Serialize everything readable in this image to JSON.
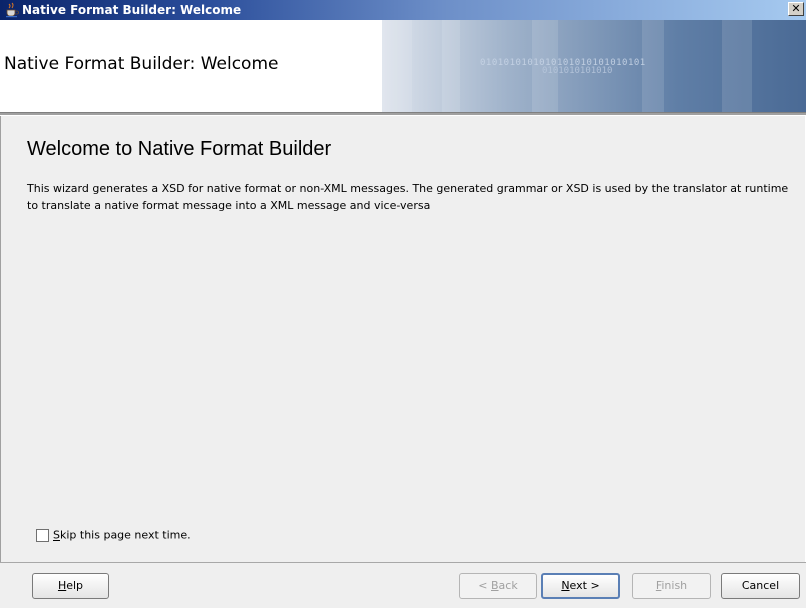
{
  "window": {
    "title": "Native Format Builder: Welcome",
    "close_glyph": "✕"
  },
  "header": {
    "title": "Native Format Builder: Welcome",
    "banner_binary_1": "0101010101010101010101010101",
    "banner_binary_2": "0101010101010"
  },
  "content": {
    "heading": "Welcome to Native Format Builder",
    "description": "This wizard generates a XSD for native format or non-XML messages. The generated grammar or XSD is used by the translator at runtime to translate a native format message into a XML message and vice-versa",
    "skip_checkbox": {
      "checked": false,
      "label_mnemonic": "S",
      "label_rest": "kip this page next time."
    }
  },
  "buttons": {
    "help": {
      "mnemonic": "H",
      "rest": "elp"
    },
    "back": {
      "prefix": "< ",
      "mnemonic": "B",
      "rest": "ack",
      "enabled": false
    },
    "next": {
      "mnemonic": "N",
      "rest": "ext >",
      "enabled": true,
      "default": true
    },
    "finish": {
      "mnemonic": "F",
      "rest": "inish",
      "enabled": false
    },
    "cancel": {
      "label": "Cancel"
    }
  },
  "icons": {
    "app": "coffee-cup-icon",
    "banner": "gear-document-icon",
    "close": "close-icon"
  },
  "colors": {
    "title_bar_start": "#0a246a",
    "title_bar_end": "#a6caf0",
    "content_bg": "#efefef",
    "default_button_border": "#5a7fb5"
  }
}
